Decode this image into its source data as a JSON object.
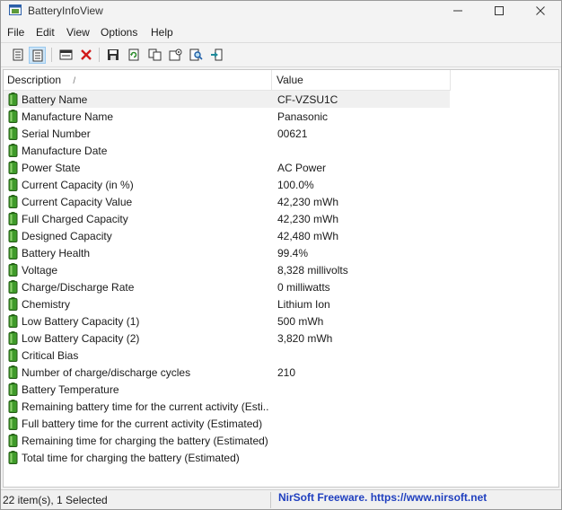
{
  "window": {
    "title": "BatteryInfoView"
  },
  "menu": [
    "File",
    "Edit",
    "View",
    "Options",
    "Help"
  ],
  "table": {
    "columns": [
      "Description",
      "Value"
    ],
    "sort_glyph": "/",
    "rows": [
      {
        "desc": "Battery Name",
        "value": "CF-VZSU1C"
      },
      {
        "desc": "Manufacture Name",
        "value": "Panasonic"
      },
      {
        "desc": "Serial Number",
        "value": "00621"
      },
      {
        "desc": "Manufacture Date",
        "value": ""
      },
      {
        "desc": "Power State",
        "value": "AC Power"
      },
      {
        "desc": "Current Capacity (in %)",
        "value": "100.0%"
      },
      {
        "desc": "Current Capacity Value",
        "value": "42,230 mWh"
      },
      {
        "desc": "Full Charged Capacity",
        "value": "42,230 mWh"
      },
      {
        "desc": "Designed Capacity",
        "value": "42,480 mWh"
      },
      {
        "desc": "Battery Health",
        "value": "99.4%"
      },
      {
        "desc": "Voltage",
        "value": "8,328 millivolts"
      },
      {
        "desc": "Charge/Discharge Rate",
        "value": "0 milliwatts"
      },
      {
        "desc": "Chemistry",
        "value": "Lithium Ion"
      },
      {
        "desc": "Low Battery Capacity (1)",
        "value": "500 mWh"
      },
      {
        "desc": "Low Battery Capacity (2)",
        "value": "3,820 mWh"
      },
      {
        "desc": "Critical Bias",
        "value": ""
      },
      {
        "desc": "Number of charge/discharge cycles",
        "value": "210"
      },
      {
        "desc": "Battery Temperature",
        "value": ""
      },
      {
        "desc": "Remaining battery time for the current activity (Esti...",
        "value": ""
      },
      {
        "desc": "Full battery time for the current activity (Estimated)",
        "value": ""
      },
      {
        "desc": "Remaining time for charging the battery (Estimated)",
        "value": ""
      },
      {
        "desc": "Total  time for charging the battery (Estimated)",
        "value": ""
      }
    ]
  },
  "status": {
    "count": "22 item(s), 1 Selected",
    "link": "NirSoft Freeware. https://www.nirsoft.net"
  },
  "colors": {
    "battery_green": "#3f9b2a",
    "link": "#1f3fbf"
  },
  "icons": [
    "app-icon",
    "minimize-icon",
    "maximize-icon",
    "close-icon",
    "html-report-icon",
    "details-icon",
    "properties-window-icon",
    "delete-icon",
    "save-icon",
    "refresh-icon",
    "copy-icon",
    "options-icon",
    "find-icon",
    "exit-icon",
    "battery-icon"
  ]
}
